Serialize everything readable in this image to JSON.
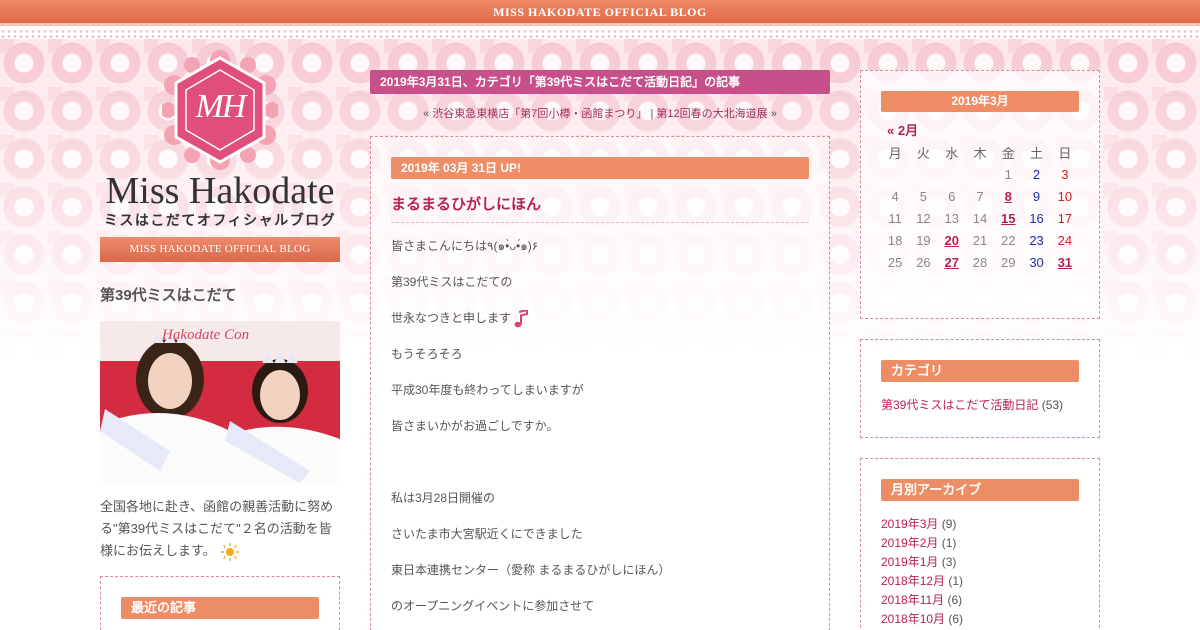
{
  "header": {
    "title": "MISS HAKODATE OFFICIAL BLOG"
  },
  "logo": {
    "emblem_letters": "MH",
    "name": "Miss Hakodate",
    "subtitle": "ミスはこだてオフィシャルブログ",
    "band": "MISS HAKODATE OFFICIAL BLOG"
  },
  "profile": {
    "heading": "第39代ミスはこだて",
    "photo_caption": "Hakodate Con",
    "description": "全国各地に赴き、函館の親善活動に努める\"第39代ミスはこだて\"２名の活動を皆様にお伝えします。"
  },
  "recent": {
    "heading": "最近の記事"
  },
  "main": {
    "date_banner": "2019年3月31日、カテゴリ「第39代ミスはこだて活動日記」の記事",
    "pager": {
      "prev_marker": "«",
      "prev_label": "渋谷東急東横店「第7回小樽・函館まつり」",
      "separator": "|",
      "next_label": "第12回春の大北海道展",
      "next_marker": "»"
    },
    "entry": {
      "up_label": "2019年 03月 31日 UP!",
      "title": "まるまるひがしにほん",
      "paragraphs": [
        "皆さまこんにちは٩(๑•̀ᴗ•́๑)۶",
        "第39代ミスはこだての",
        "世永なつきと申します",
        "もうそろそろ",
        "平成30年度も終わってしまいますが",
        "皆さまいかがお過ごしですか。",
        "",
        "私は3月28日開催の",
        "さいたま市大宮駅近くにできました",
        "東日本連携センター（愛称 まるまるひがしにほん）",
        "のオープニングイベントに参加させて"
      ]
    }
  },
  "calendar": {
    "heading": "2019年3月",
    "prev_label": "« 2月",
    "weekdays": [
      "月",
      "火",
      "水",
      "木",
      "金",
      "土",
      "日"
    ],
    "weeks": [
      [
        "",
        "",
        "",
        "",
        "1",
        "2",
        "3"
      ],
      [
        "4",
        "5",
        "6",
        "7",
        "8",
        "9",
        "10"
      ],
      [
        "11",
        "12",
        "13",
        "14",
        "15",
        "16",
        "17"
      ],
      [
        "18",
        "19",
        "20",
        "21",
        "22",
        "23",
        "24"
      ],
      [
        "25",
        "26",
        "27",
        "28",
        "29",
        "30",
        "31"
      ]
    ],
    "linked_days": [
      "8",
      "15",
      "20",
      "27",
      "31"
    ]
  },
  "categories": {
    "heading": "カテゴリ",
    "items": [
      {
        "label": "第39代ミスはこだて活動日記",
        "count": "(53)"
      }
    ]
  },
  "archives": {
    "heading": "月別アーカイブ",
    "items": [
      {
        "label": "2019年3月",
        "count": "(9)"
      },
      {
        "label": "2019年2月",
        "count": "(1)"
      },
      {
        "label": "2019年1月",
        "count": "(3)"
      },
      {
        "label": "2018年12月",
        "count": "(1)"
      },
      {
        "label": "2018年11月",
        "count": "(6)"
      },
      {
        "label": "2018年10月",
        "count": "(6)"
      }
    ]
  },
  "colors": {
    "accent_orange": "#ee8d66",
    "banner_magenta": "#c8508a",
    "link_crimson": "#b81f55",
    "saturday_blue": "#1e2fb5",
    "sunday_red": "#cc2222"
  }
}
